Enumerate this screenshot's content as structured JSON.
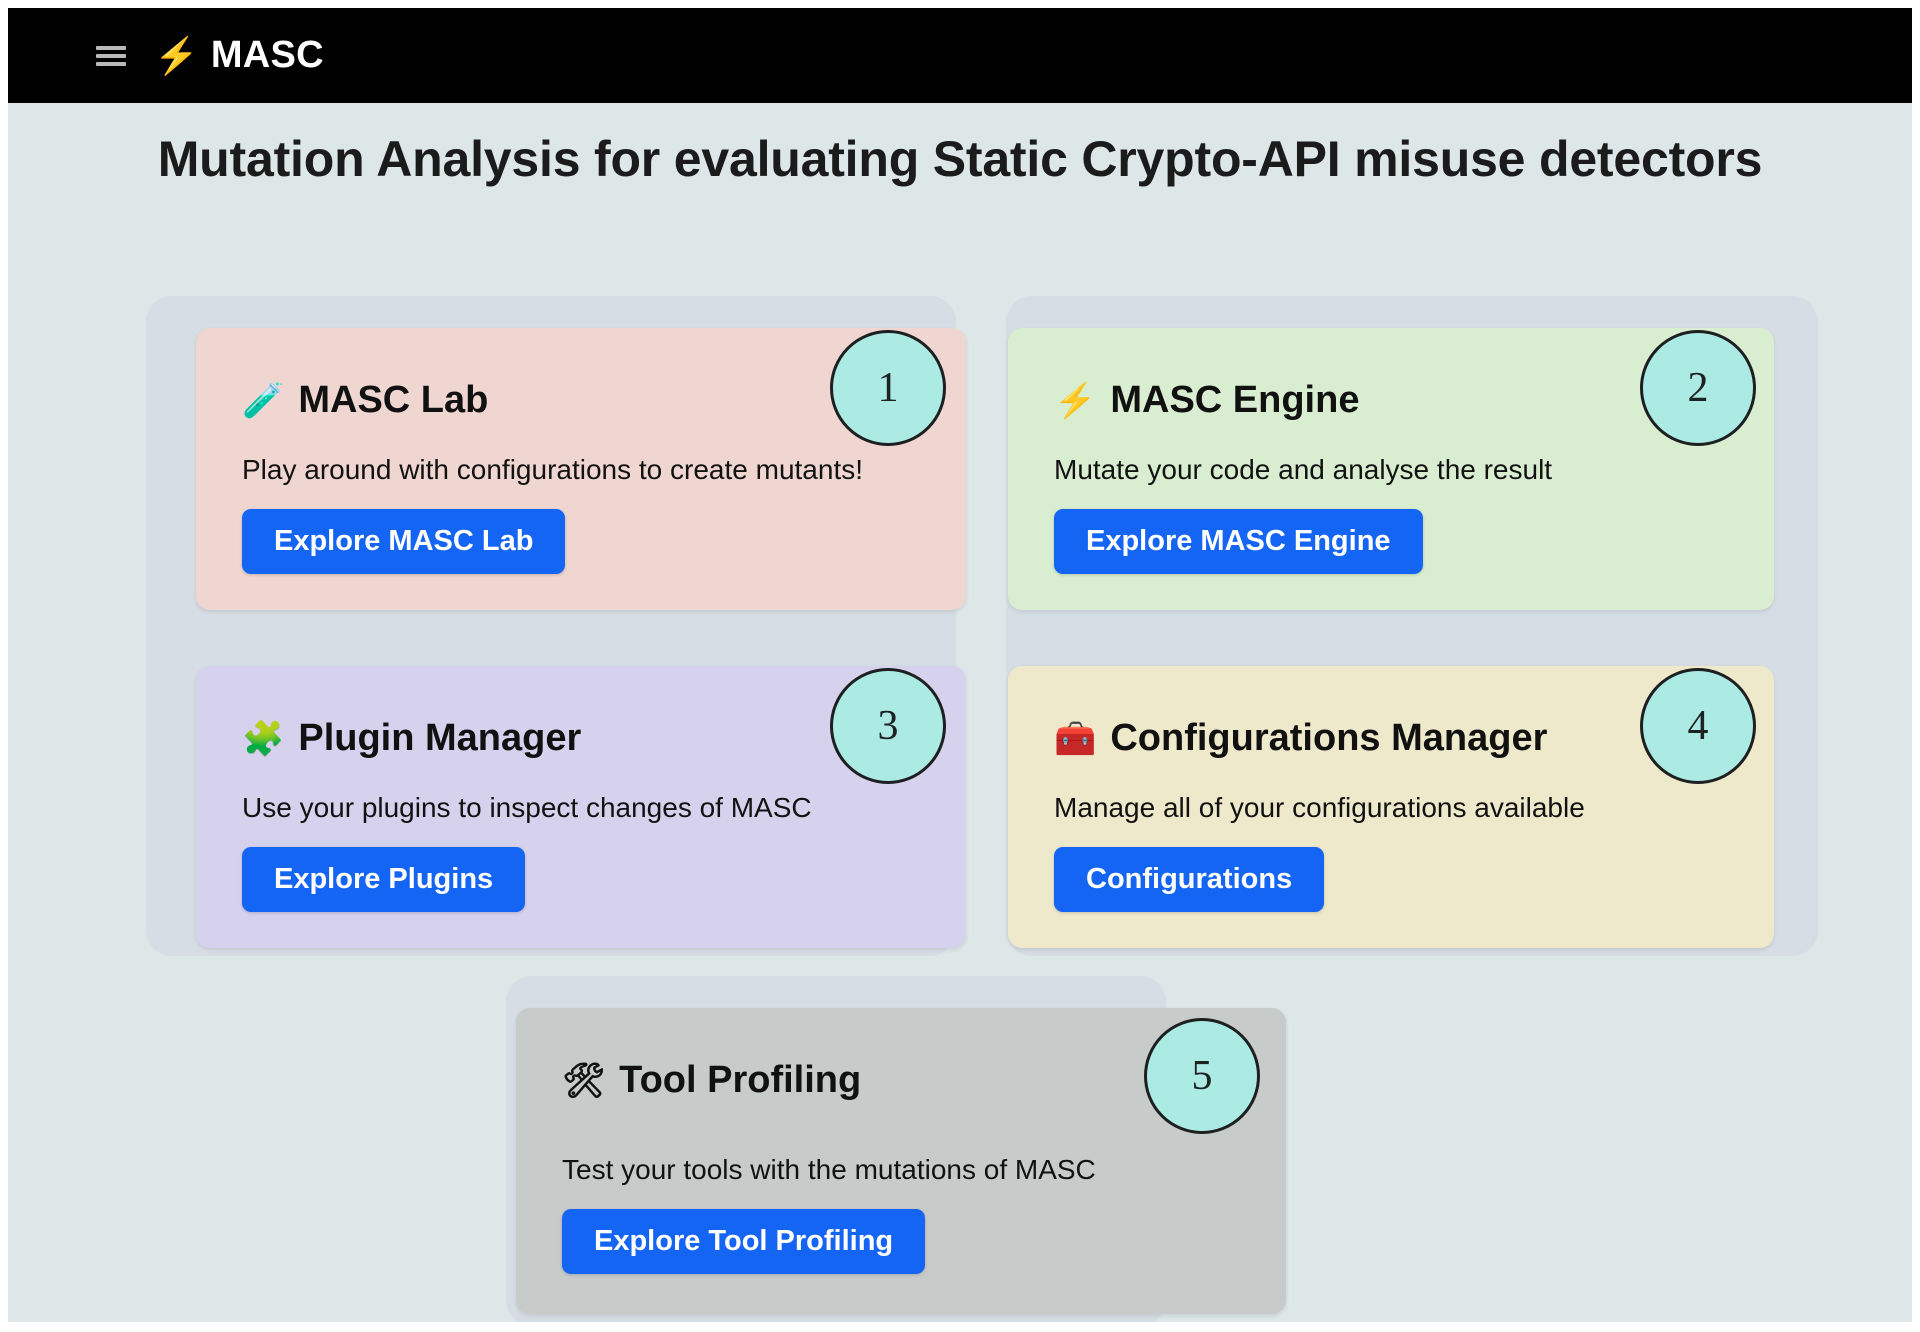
{
  "header": {
    "menu_icon": "hamburger-menu-icon",
    "brand_icon": "⚡",
    "brand_text": "MASC"
  },
  "page": {
    "title": "Mutation Analysis for evaluating Static Crypto-API misuse detectors",
    "background_color": "#dde7e7",
    "panel_color": "#d6dde5",
    "button_color": "#1565f5",
    "badge_color": "#aceae4"
  },
  "cards": [
    {
      "number": "1",
      "emoji": "🧪",
      "emoji_name": "test-tube-icon",
      "title": "MASC Lab",
      "description": "Play around with configurations to create mutants!",
      "button_label": "Explore MASC Lab",
      "color": "#f0d6d0"
    },
    {
      "number": "2",
      "emoji": "⚡",
      "emoji_name": "lightning-bolt-icon",
      "title": "MASC Engine",
      "description": "Mutate your code and analyse the result",
      "button_label": "Explore MASC Engine",
      "color": "#d9eed0"
    },
    {
      "number": "3",
      "emoji": "🧩",
      "emoji_name": "puzzle-piece-icon",
      "title": "Plugin Manager",
      "description": "Use your plugins to inspect changes of MASC",
      "button_label": "Explore Plugins",
      "color": "#d6d2ee"
    },
    {
      "number": "4",
      "emoji": "🧰",
      "emoji_name": "toolbox-icon",
      "title": "Configurations Manager",
      "description": "Manage all of your configurations available",
      "button_label": "Configurations",
      "color": "#efe9cc"
    },
    {
      "number": "5",
      "emoji": "🛠",
      "emoji_name": "hammer-and-wrench-icon",
      "title": "Tool Profiling",
      "description": "Test your tools with the mutations of MASC",
      "button_label": "Explore Tool Profiling",
      "color": "#c7cbca"
    }
  ]
}
